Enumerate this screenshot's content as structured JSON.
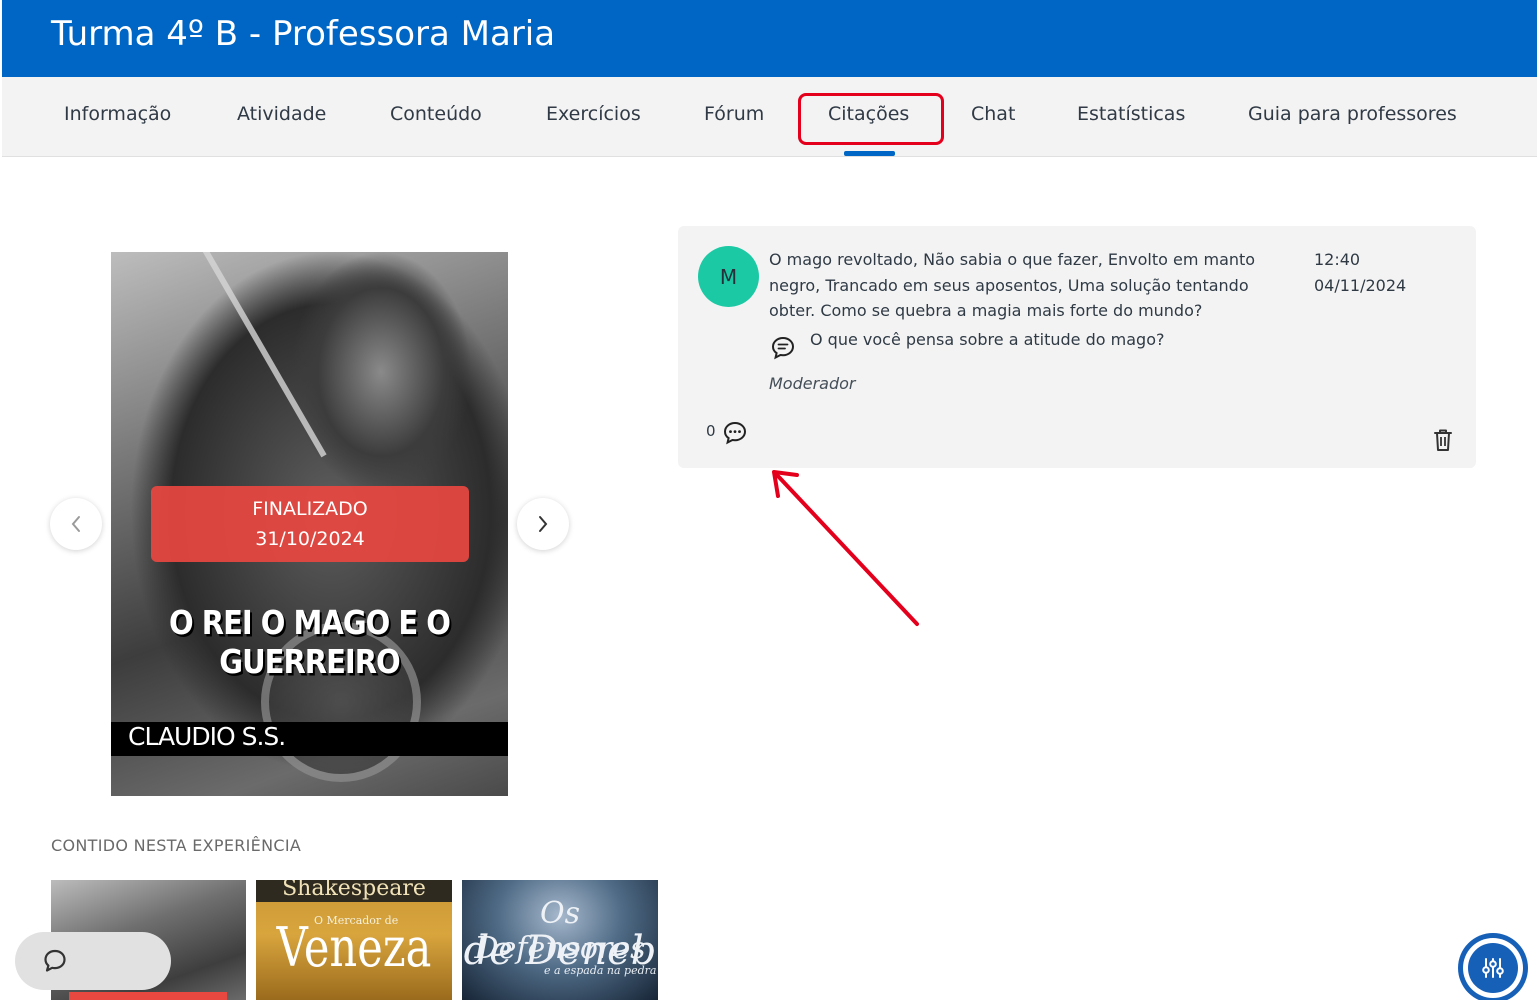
{
  "header": {
    "title": "Turma 4º B - Professora Maria"
  },
  "nav": {
    "tabs": [
      {
        "label": "Informação"
      },
      {
        "label": "Atividade"
      },
      {
        "label": "Conteúdo"
      },
      {
        "label": "Exercícios"
      },
      {
        "label": "Fórum"
      },
      {
        "label": "Citações",
        "active": true
      },
      {
        "label": "Chat"
      },
      {
        "label": "Estatísticas"
      },
      {
        "label": "Guia para professores"
      }
    ]
  },
  "book": {
    "status": "FINALIZADO",
    "date": "31/10/2024",
    "title": "O REI O MAGO E O GUERREIRO",
    "author": "CLAUDIO S.S."
  },
  "section": {
    "label": "CONTIDO NESTA EXPERIÊNCIA"
  },
  "thumbnails": [
    {
      "name": "O Rei o Mago e o Guerreiro"
    },
    {
      "t1": "Shakespeare",
      "t2": "O Mercador de",
      "t3": "Veneza"
    },
    {
      "t1": "Os Defensores",
      "t2": "de Deneb",
      "t3": "e a espada na pedra"
    }
  ],
  "quote": {
    "avatar_letter": "M",
    "text": "O mago revoltado, Não sabia o que fazer, Envolto em manto negro, Trancado em seus aposentos,  Uma solução tentando obter. Como se quebra a magia mais forte do mundo?",
    "time": "12:40",
    "date": "04/11/2024",
    "question": "O que você pensa sobre a atitude do mago?",
    "author_role": "Moderador",
    "reply_count": "0"
  },
  "icons": {
    "prev": "chevron-left-icon",
    "next": "chevron-right-icon",
    "chat": "chat-bubble-icon",
    "question": "comment-lines-icon",
    "reply": "comment-dots-icon",
    "delete": "trash-icon",
    "settings": "sliders-icon"
  },
  "colors": {
    "brand": "#0066c5",
    "highlight": "#e4001c",
    "avatar": "#1bc9a4",
    "badge": "#e84840"
  }
}
